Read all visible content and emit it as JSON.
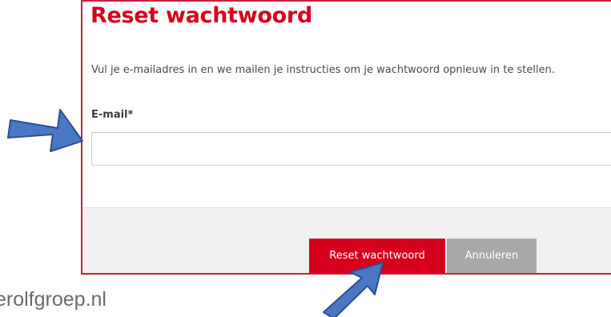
{
  "dialog": {
    "title": "Reset wachtwoord",
    "description": "Vul je e-mailadres in en we mailen je instructies om je wachtwoord opnieuw in te stellen.",
    "email_label": "E-mail*",
    "email_value": "",
    "email_placeholder": ""
  },
  "buttons": {
    "reset_label": "Reset wachtwoord",
    "cancel_label": "Annuleren"
  },
  "footer_text": "erolfgroep.nl",
  "colors": {
    "accent": "#d6001c",
    "border": "#cc1f3a",
    "cancel": "#a9a9a9",
    "arrow": "#4a77c4"
  },
  "annotations": [
    {
      "icon": "arrow-right-icon",
      "points_to": "email-input"
    },
    {
      "icon": "arrow-up-right-icon",
      "points_to": "reset-password-button"
    }
  ]
}
